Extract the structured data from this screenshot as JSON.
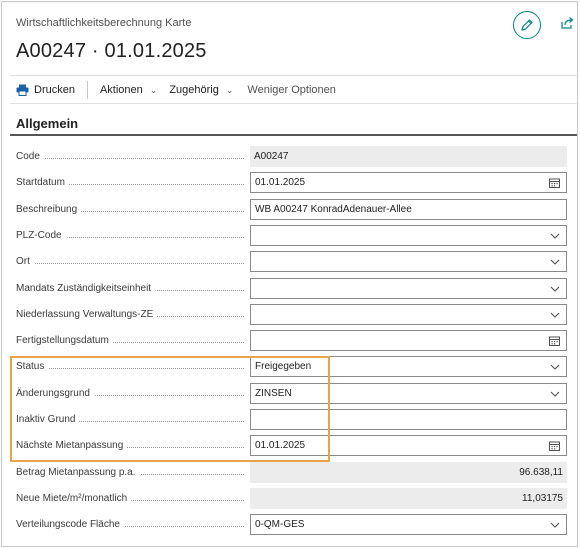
{
  "header": {
    "caption": "Wirtschaftlichkeitsberechnung Karte",
    "title": "A00247 · 01.01.2025",
    "edit_icon": "pencil-icon",
    "share_icon": "share-icon"
  },
  "actions": {
    "print_label": "Drucken",
    "actions_label": "Aktionen",
    "related_label": "Zugehörig",
    "fewer_options_label": "Weniger Optionen"
  },
  "section": {
    "title": "Allgemein"
  },
  "fields": [
    {
      "label": "Code",
      "value": "A00247",
      "kind": "readonly"
    },
    {
      "label": "Startdatum",
      "value": "01.01.2025",
      "kind": "date"
    },
    {
      "label": "Beschreibung",
      "value": "WB A00247 KonradAdenauer-Allee",
      "kind": "text"
    },
    {
      "label": "PLZ-Code",
      "value": "",
      "kind": "select"
    },
    {
      "label": "Ort",
      "value": "",
      "kind": "select"
    },
    {
      "label": "Mandats Zuständigkeitseinheit",
      "value": "",
      "kind": "select"
    },
    {
      "label": "Niederlassung Verwaltungs-ZE",
      "value": "",
      "kind": "select"
    },
    {
      "label": "Fertigstellungsdatum",
      "value": "",
      "kind": "date"
    },
    {
      "label": "Status",
      "value": "Freigegeben",
      "kind": "select"
    },
    {
      "label": "Änderungsgrund",
      "value": "ZINSEN",
      "kind": "select"
    },
    {
      "label": "Inaktiv Grund",
      "value": "",
      "kind": "text"
    },
    {
      "label": "Nächste Mietanpassung",
      "value": "01.01.2025",
      "kind": "date"
    },
    {
      "label": "Betrag Mietanpassung p.a.",
      "value": "96.638,11",
      "kind": "readonly-num"
    },
    {
      "label": "Neue Miete/m²/monatlich",
      "value": "11,03175",
      "kind": "readonly-num"
    },
    {
      "label": "Verteilungscode Fläche",
      "value": "0-QM-GES",
      "kind": "select"
    }
  ],
  "colors": {
    "accent": "#008489",
    "highlight": "#e8a548",
    "print_icon": "#1a5fa8"
  }
}
